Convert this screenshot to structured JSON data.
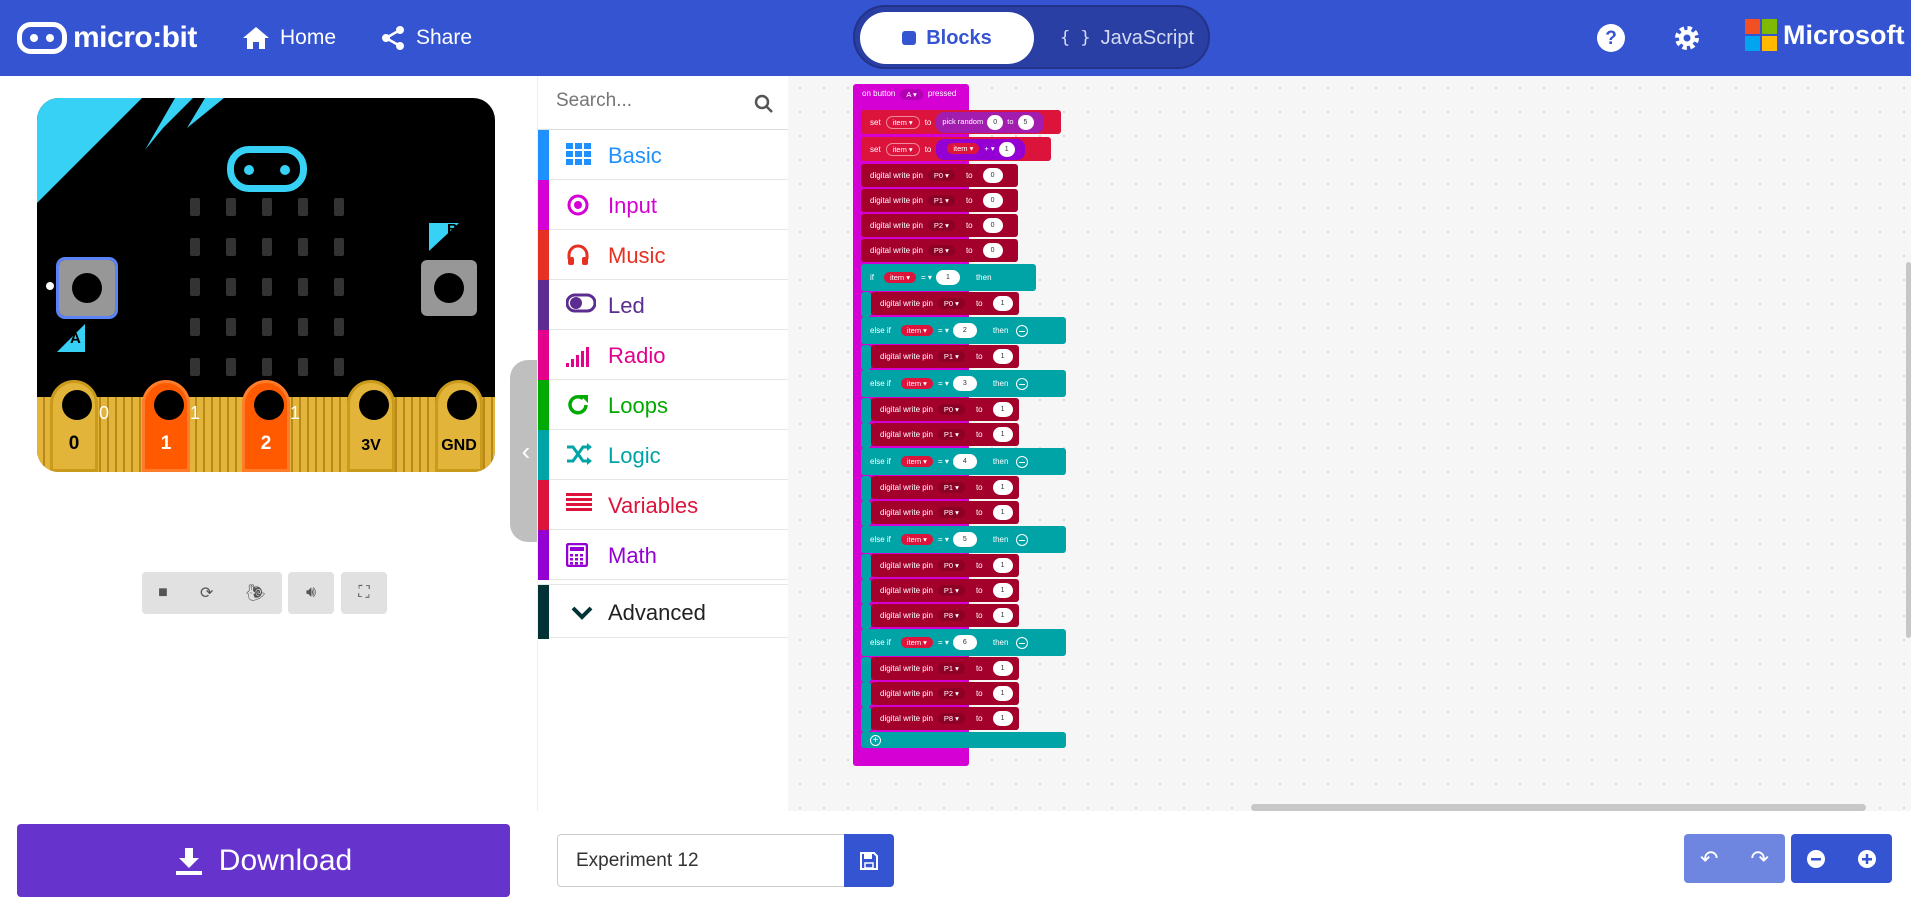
{
  "header": {
    "logo_text": "micro:bit",
    "home_label": "Home",
    "share_label": "Share",
    "blocks_label": "Blocks",
    "javascript_label": "JavaScript",
    "javascript_glyph": "{ }",
    "brand_label": "Microsoft",
    "colors": {
      "bar": "#3454D1"
    }
  },
  "simulator": {
    "pin_labels": [
      "0",
      "1",
      "2",
      "3V",
      "GND"
    ],
    "pin_values": [
      "0",
      "1",
      "1"
    ],
    "button_a": "A",
    "button_b": "B",
    "toolbar": [
      "stop-icon",
      "restart-icon",
      "slow-mo-icon",
      "mute-icon",
      "fullscreen-icon"
    ]
  },
  "toolbox": {
    "search_placeholder": "Search...",
    "categories": [
      {
        "label": "Basic",
        "color": "#1e90ff",
        "icon": "grid-icon"
      },
      {
        "label": "Input",
        "color": "#d400d4",
        "icon": "target-icon"
      },
      {
        "label": "Music",
        "color": "#e63022",
        "icon": "headphones-icon"
      },
      {
        "label": "Led",
        "color": "#5c2d91",
        "icon": "toggle-icon"
      },
      {
        "label": "Radio",
        "color": "#e3008c",
        "icon": "signal-icon"
      },
      {
        "label": "Loops",
        "color": "#00aa00",
        "icon": "refresh-icon"
      },
      {
        "label": "Logic",
        "color": "#00a4a6",
        "icon": "shuffle-icon"
      },
      {
        "label": "Variables",
        "color": "#dc143c",
        "icon": "list-icon"
      },
      {
        "label": "Math",
        "color": "#9400d3",
        "icon": "calculator-icon"
      }
    ],
    "advanced_label": "Advanced"
  },
  "workspace": {
    "event": {
      "on": "on button",
      "btn": "A ▾",
      "pressed": "pressed"
    },
    "kw": {
      "set": "set",
      "to": "to",
      "if": "if",
      "then": "then",
      "else_if": "else if",
      "digital_write_pin": "digital write pin",
      "pick_random": "pick random",
      "item": "item ▾",
      "eq": "= ▾",
      "plus": "+ ▾"
    },
    "set1": {
      "from": "0",
      "to": "5"
    },
    "set2": {
      "add": "1"
    },
    "init_writes": [
      {
        "pin": "P0 ▾",
        "val": "0"
      },
      {
        "pin": "P1 ▾",
        "val": "0"
      },
      {
        "pin": "P2 ▾",
        "val": "0"
      },
      {
        "pin": "P8 ▾",
        "val": "0"
      }
    ],
    "branches": [
      {
        "cmp": "1",
        "writes": [
          {
            "pin": "P0 ▾",
            "val": "1"
          }
        ]
      },
      {
        "cmp": "2",
        "writes": [
          {
            "pin": "P1 ▾",
            "val": "1"
          }
        ]
      },
      {
        "cmp": "3",
        "writes": [
          {
            "pin": "P0 ▾",
            "val": "1"
          },
          {
            "pin": "P1 ▾",
            "val": "1"
          }
        ]
      },
      {
        "cmp": "4",
        "writes": [
          {
            "pin": "P1 ▾",
            "val": "1"
          },
          {
            "pin": "P8 ▾",
            "val": "1"
          }
        ]
      },
      {
        "cmp": "5",
        "writes": [
          {
            "pin": "P0 ▾",
            "val": "1"
          },
          {
            "pin": "P1 ▾",
            "val": "1"
          },
          {
            "pin": "P8 ▾",
            "val": "1"
          }
        ]
      },
      {
        "cmp": "6",
        "writes": [
          {
            "pin": "P1 ▾",
            "val": "1"
          },
          {
            "pin": "P2 ▾",
            "val": "1"
          },
          {
            "pin": "P8 ▾",
            "val": "1"
          }
        ]
      }
    ]
  },
  "bottom": {
    "download_label": "Download",
    "project_name": "Experiment 12"
  }
}
